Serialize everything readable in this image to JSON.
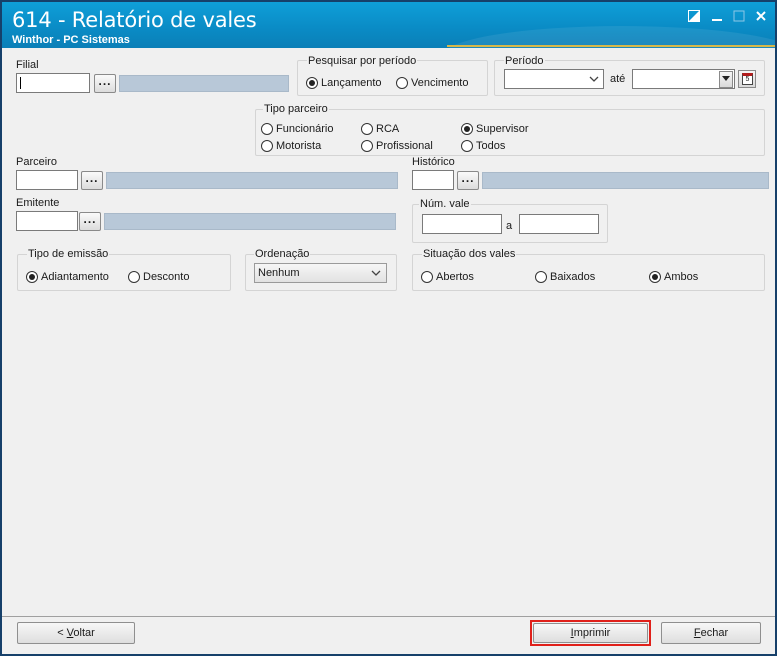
{
  "window": {
    "title": "614 - Relatório de vales",
    "subtitle": "Winthor - PC Sistemas"
  },
  "filial": {
    "label": "Filial",
    "value": "",
    "lookup_label": "..."
  },
  "pesquisar": {
    "label": "Pesquisar por período",
    "options": [
      "Lançamento",
      "Vencimento"
    ],
    "selected": "Lançamento"
  },
  "periodo": {
    "label": "Período",
    "ate_label": "até",
    "start": "",
    "end": ""
  },
  "tipo_parceiro": {
    "label": "Tipo parceiro",
    "options": [
      "Funcionário",
      "RCA",
      "Supervisor",
      "Motorista",
      "Profissional",
      "Todos"
    ],
    "selected": "Supervisor"
  },
  "parceiro": {
    "label": "Parceiro",
    "value": "",
    "lookup_label": "..."
  },
  "historico": {
    "label": "Histórico",
    "value": "",
    "lookup_label": "..."
  },
  "emitente": {
    "label": "Emitente",
    "value": "",
    "lookup_label": "..."
  },
  "num_vale": {
    "label": "Núm. vale",
    "a_label": "a",
    "from": "",
    "to": ""
  },
  "tipo_emissao": {
    "label": "Tipo de emissão",
    "options": [
      "Adiantamento",
      "Desconto"
    ],
    "selected": "Adiantamento"
  },
  "ordenacao": {
    "label": "Ordenação",
    "value": "Nenhum"
  },
  "situacao": {
    "label": "Situação dos vales",
    "options": [
      "Abertos",
      "Baixados",
      "Ambos"
    ],
    "selected": "Ambos"
  },
  "footer": {
    "voltar_prefix": "< ",
    "voltar_key": "V",
    "voltar_rest": "oltar",
    "imprimir_key": "I",
    "imprimir_rest": "mprimir",
    "fechar_key": "F",
    "fechar_rest": "echar"
  },
  "colors": {
    "title_bar": "#0a8cc6",
    "highlight": "#e0201a",
    "readonly_field": "#b8c8d8"
  }
}
